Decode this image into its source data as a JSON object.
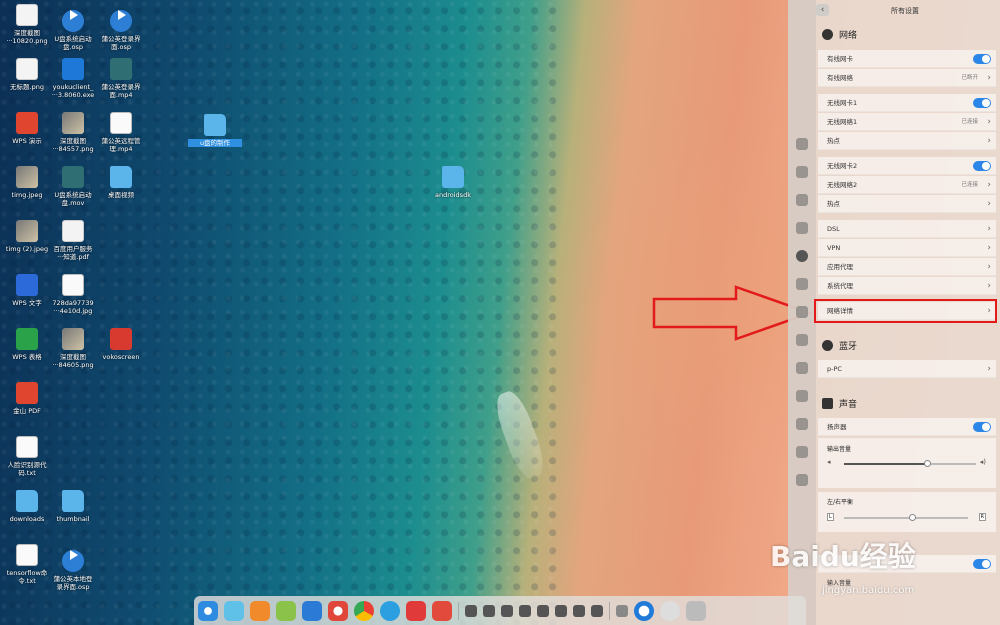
{
  "desktop": {
    "icons": [
      {
        "label": "深度截图\n···10820.png",
        "kind": "png"
      },
      {
        "label": "U盘系统启动\n盘.osp",
        "kind": "blue"
      },
      {
        "label": "蒲公英登录界\n面.osp",
        "kind": "blue"
      },
      {
        "label": "无标题.png",
        "kind": "png"
      },
      {
        "label": "youkuclient_\n···3.8060.exe",
        "kind": "exe"
      },
      {
        "label": "蒲公英登录界\n面.mp4",
        "kind": "video"
      },
      {
        "label": "WPS 演示",
        "kind": "red"
      },
      {
        "label": "深度截图\n···84557.png",
        "kind": "photo"
      },
      {
        "label": "蒲公英远程管\n理.mp4",
        "kind": "doc"
      },
      {
        "label": "timg.jpeg",
        "kind": "photo"
      },
      {
        "label": "U盘系统启动\n盘.mov",
        "kind": "video"
      },
      {
        "label": "桌面视频",
        "kind": "folder"
      },
      {
        "label": "timg (2).jpeg",
        "kind": "photo"
      },
      {
        "label": "百度用户服务\n···知道.pdf",
        "kind": "pdf"
      },
      {
        "label": "WPS 文字",
        "kind": "wps-w"
      },
      {
        "label": "728da97739\n···4e10d.jpg",
        "kind": "doc"
      },
      {
        "label": "WPS 表格",
        "kind": "wps-s"
      },
      {
        "label": "深度截图\n···84605.png",
        "kind": "photo"
      },
      {
        "label": "vokoscreen",
        "kind": "rec"
      },
      {
        "label": "金山 PDF",
        "kind": "red"
      },
      {
        "label": "人脸识别源代\n码.txt",
        "kind": "doc"
      },
      {
        "label": "downloads",
        "kind": "folder"
      },
      {
        "label": "thumbnail",
        "kind": "folder"
      },
      {
        "label": "tensorflow命\n令.txt",
        "kind": "doc"
      },
      {
        "label": "蒲公英本地登\n录界面.osp",
        "kind": "blue"
      },
      {
        "label": "u盘的制作",
        "kind": "folder"
      },
      {
        "label": "androidsdk",
        "kind": "folder"
      }
    ]
  },
  "settings": {
    "title": "所有设置",
    "back_icon": "chevron-left-icon",
    "network": {
      "heading": "网络",
      "wired_card": "有线网卡",
      "wired_net": "有线网络",
      "wired_status": "已断开",
      "wireless_card1": "无线网卡1",
      "wireless_net1": "无线网络1",
      "wireless_status1": "已连接",
      "hotspot1": "热点",
      "wireless_card2": "无线网卡2",
      "wireless_net2": "无线网络2",
      "wireless_status2": "已连接",
      "hotspot2": "热点",
      "dsl": "DSL",
      "vpn": "VPN",
      "app_proxy": "应用代理",
      "system_proxy": "系统代理",
      "details": "网络详情"
    },
    "bluetooth": {
      "heading": "蓝牙",
      "device": "p-PC"
    },
    "sound": {
      "heading": "声音",
      "speaker": "扬声器",
      "output_volume": "输出音量",
      "output_volume_level": 0.63,
      "balance": "左/右平衡",
      "balance_level": 0.55,
      "balance_left": "L",
      "balance_right": "R",
      "input_volume": "输入音量"
    }
  },
  "watermark": {
    "brand": "Baidu经验",
    "url": "jingyan.baidu.com"
  },
  "colors": {
    "toggle_on": "#2c86e8",
    "highlight": "#e21a1a"
  }
}
